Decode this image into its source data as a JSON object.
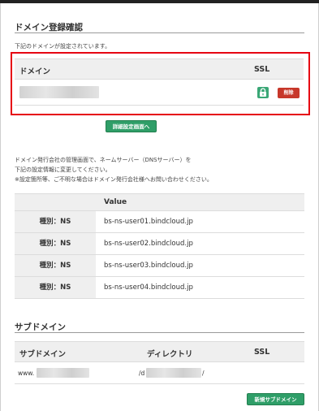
{
  "domain_section": {
    "title": "ドメイン登録確認",
    "description": "下記のドメインが設定されています。",
    "col_domain": "ドメイン",
    "col_ssl": "SSL",
    "delete_label": "削除",
    "detail_button": "詳細設定画面へ"
  },
  "ns_section": {
    "note_line1": "ドメイン発行会社の管理画面で、ネームサーバー（DNSサーバー）を",
    "note_line2": "下記の設定情報に変更してください。",
    "note_line3": "※設定箇所等、ご不明な場合はドメイン発行会社様へお問い合わせください。",
    "col_value": "Value",
    "rows": [
      {
        "type": "種別：NS",
        "value": "bs-ns-user01.bindcloud.jp"
      },
      {
        "type": "種別：NS",
        "value": "bs-ns-user02.bindcloud.jp"
      },
      {
        "type": "種別：NS",
        "value": "bs-ns-user03.bindcloud.jp"
      },
      {
        "type": "種別：NS",
        "value": "bs-ns-user04.bindcloud.jp"
      }
    ]
  },
  "subdomain_section": {
    "title": "サブドメイン",
    "col_subdomain": "サブドメイン",
    "col_directory": "ディレクトリ",
    "col_ssl": "SSL",
    "row_prefix": "www.",
    "dir_prefix": "/d",
    "dir_suffix": "/",
    "new_button": "新規サブドメイン"
  },
  "colors": {
    "highlight": "#e60012",
    "green": "#2f9e68",
    "delete": "#c7372a"
  }
}
